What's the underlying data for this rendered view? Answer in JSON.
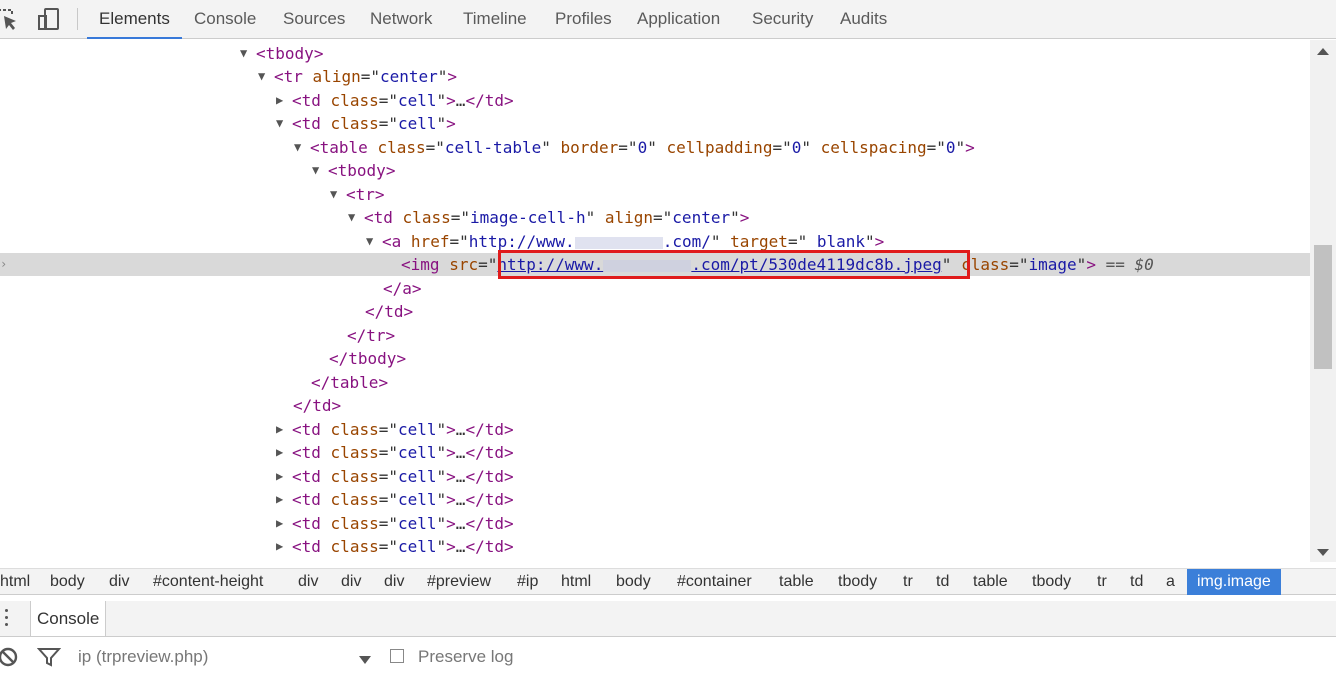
{
  "toolbar": {
    "tabs": [
      "Elements",
      "Console",
      "Sources",
      "Network",
      "Timeline",
      "Profiles",
      "Application",
      "Security",
      "Audits"
    ],
    "icons": [
      "inspect-icon",
      "device-mode-icon"
    ]
  },
  "tree": {
    "tbody": "tbody",
    "tr": "tr",
    "td": "td",
    "table": "table",
    "a": "a",
    "img": "img",
    "ellipsis": "…",
    "attr_align": "align",
    "attr_class": "class",
    "attr_border": "border",
    "attr_cellpadding": "cellpadding",
    "attr_cellspacing": "cellspacing",
    "attr_href": "href",
    "attr_target": "target",
    "attr_src": "src",
    "val_center": "center",
    "val_cell": "cell",
    "val_cell_table": "cell-table",
    "val_zero": "0",
    "val_image_cell_h": "image-cell-h",
    "val_href_prefix": "http://www.",
    "val_href_suffix": ".com/",
    "val_blank": "_blank",
    "val_src_prefix": "http://www.",
    "val_src_suffix": ".com/pt/530de4119dc8b.jpeg",
    "val_image": "image",
    "selected_marker": "== $0"
  },
  "breadcrumbs": [
    "html",
    "body",
    "div",
    "#content-height",
    "div",
    "div",
    "div",
    "#preview",
    "#ip",
    "html",
    "body",
    "#container",
    "table",
    "tbody",
    "tr",
    "td",
    "table",
    "tbody",
    "tr",
    "td",
    "a",
    "img.image"
  ],
  "drawer": {
    "tab": "Console",
    "context": "ip (trpreview.php)",
    "preserve_log": "Preserve log"
  }
}
